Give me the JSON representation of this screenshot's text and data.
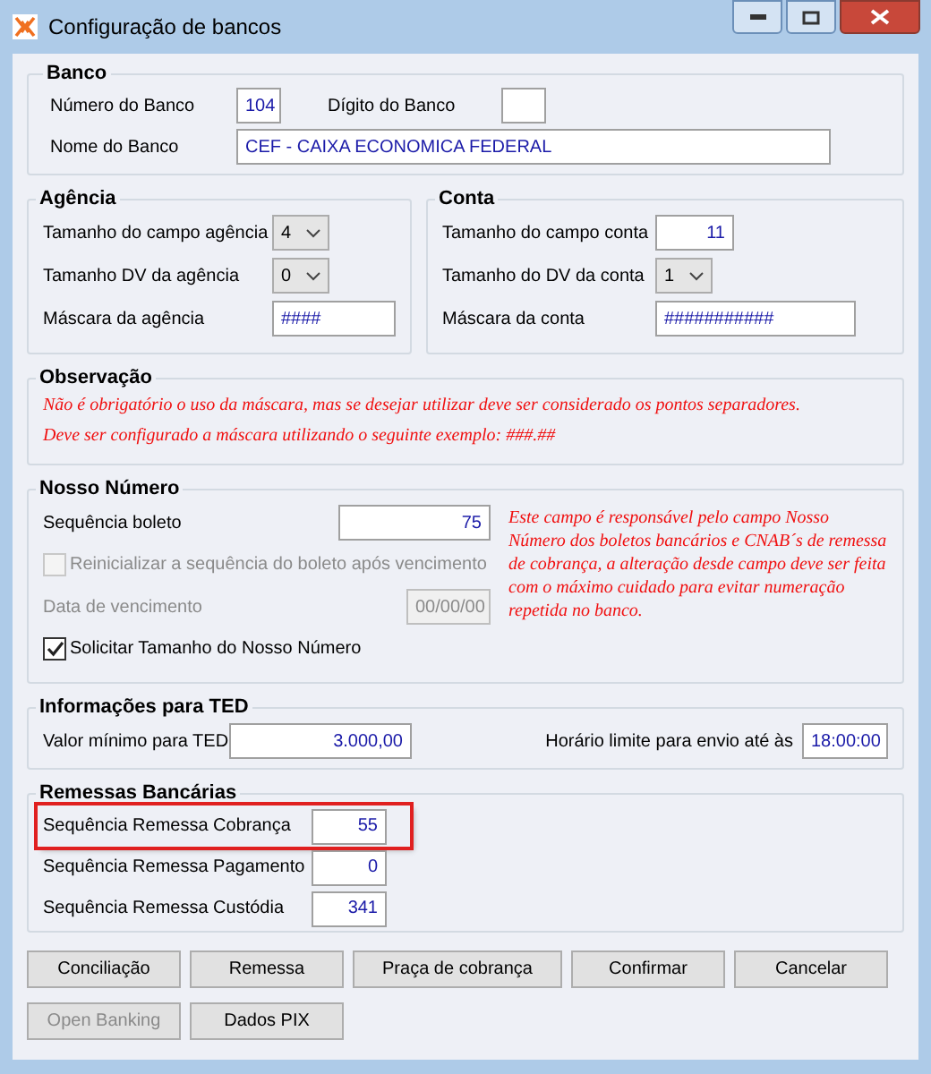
{
  "window": {
    "title": "Configuração de bancos"
  },
  "banco": {
    "title": "Banco",
    "numero": {
      "label": "Número do Banco",
      "value": "104"
    },
    "digito": {
      "label": "Dígito do Banco"
    },
    "nome": {
      "label": "Nome do Banco",
      "value": "CEF - CAIXA ECONOMICA FEDERAL"
    }
  },
  "agencia": {
    "title": "Agência",
    "fields": [
      {
        "kind": "select",
        "label": "Tamanho do campo agência",
        "value": "4"
      },
      {
        "kind": "select",
        "label": "Tamanho DV da agência",
        "value": "0"
      },
      {
        "kind": "input",
        "label": "Máscara da agência",
        "value": "####"
      }
    ]
  },
  "conta": {
    "title": "Conta",
    "fields": [
      {
        "kind": "number",
        "label": "Tamanho do campo conta",
        "value": "11"
      },
      {
        "kind": "select",
        "label": "Tamanho do DV da conta",
        "value": "1"
      },
      {
        "kind": "input",
        "label": "Máscara da conta",
        "value": "###########"
      }
    ]
  },
  "observacao": {
    "title": "Observação",
    "lines": [
      "Não é obrigatório o uso da máscara, mas se desejar utilizar deve ser considerado os pontos separadores.",
      "Deve ser configurado a máscara utilizando o seguinte exemplo: ###.##"
    ]
  },
  "nosso_numero": {
    "title": "Nosso Número",
    "sequencia": {
      "label": "Sequência boleto",
      "value": "75"
    },
    "reinicializar": {
      "label": "Reinicializar a sequência do boleto após vencimento",
      "checked": false,
      "disabled": true
    },
    "data_vencimento": {
      "label": "Data de vencimento",
      "value": "00/00/00",
      "disabled": true
    },
    "solicitar": {
      "label": "Solicitar Tamanho do Nosso Número",
      "checked": true,
      "disabled": false
    },
    "note": "Este campo é responsável pelo campo Nosso Número dos boletos bancários e CNAB´s de remessa de cobrança, a alteração desde campo deve ser feita com o máximo cuidado para evitar numeração repetida no banco."
  },
  "ted": {
    "title": "Informações para TED",
    "valor": {
      "label": "Valor mínimo para TED",
      "value": "3.000,00"
    },
    "horario": {
      "label": "Horário limite para envio até às",
      "value": "18:00:00"
    }
  },
  "remessas": {
    "title": "Remessas Bancárias",
    "rows": [
      {
        "label": "Sequência Remessa Cobrança",
        "value": "55",
        "highlighted": true
      },
      {
        "label": "Sequência Remessa Pagamento",
        "value": "0",
        "highlighted": false
      },
      {
        "label": "Sequência Remessa Custódia",
        "value": "341",
        "highlighted": false
      }
    ]
  },
  "buttons": [
    [
      {
        "label": "Conciliação",
        "disabled": false
      },
      {
        "label": "Remessa",
        "disabled": false
      },
      {
        "label": "Praça de cobrança",
        "disabled": false
      },
      {
        "label": "Confirmar",
        "disabled": false
      },
      {
        "label": "Cancelar",
        "disabled": false
      }
    ],
    [
      {
        "label": "Open Banking",
        "disabled": true
      },
      {
        "label": "Dados PIX",
        "disabled": false
      }
    ]
  ]
}
